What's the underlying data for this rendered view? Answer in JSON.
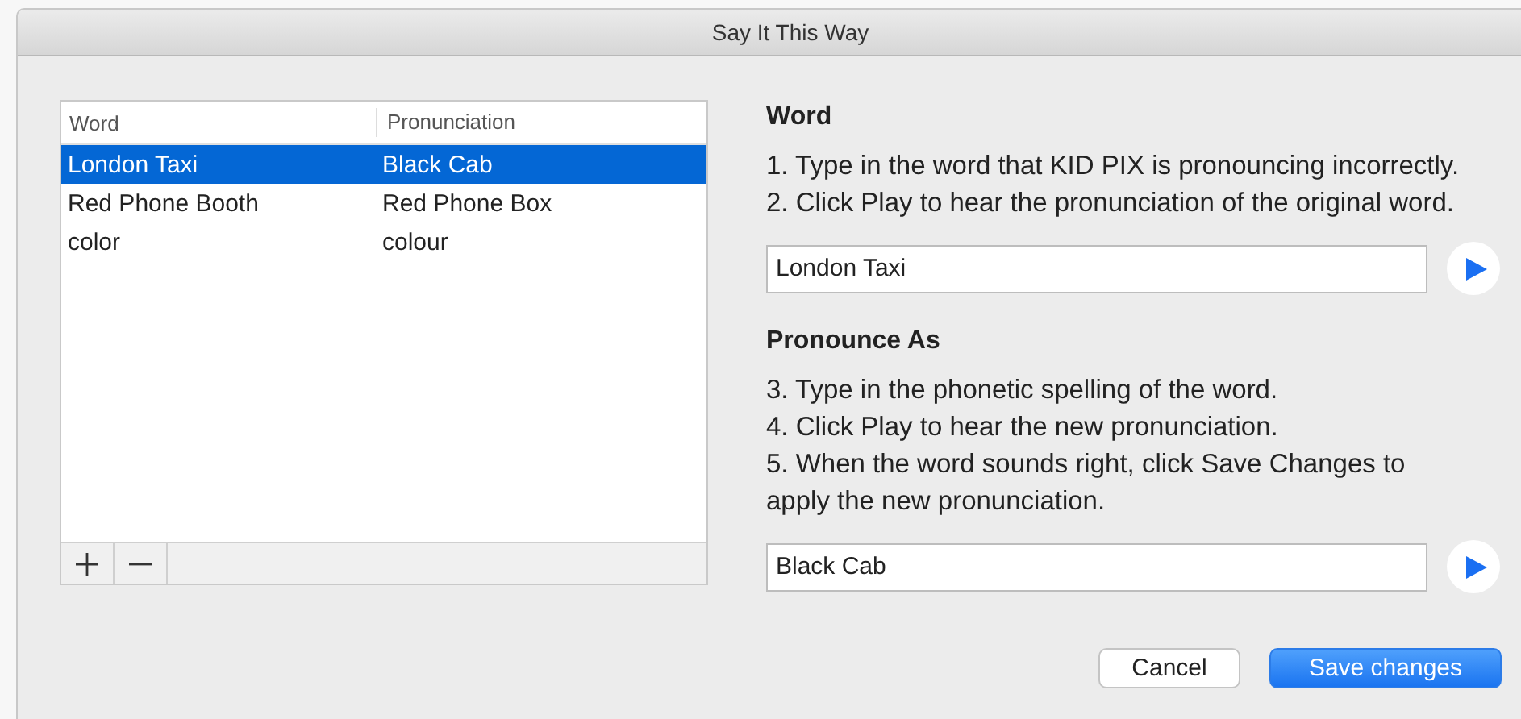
{
  "window": {
    "title": "Say It This Way"
  },
  "table": {
    "columns": [
      "Word",
      "Pronunciation"
    ],
    "rows": [
      {
        "cells": [
          "London Taxi",
          "Black Cab"
        ],
        "selected": true
      },
      {
        "cells": [
          "Red Phone Booth",
          "Red Phone Box"
        ],
        "selected": false
      },
      {
        "cells": [
          "color",
          "colour"
        ],
        "selected": false
      }
    ]
  },
  "sections": [
    {
      "heading": "Word",
      "instructions": [
        "1. Type in the word that KID PIX is pronouncing incorrectly.",
        "2. Click Play to hear the pronunciation of the original word."
      ],
      "field": {
        "value": "London Taxi"
      }
    },
    {
      "heading": "Pronounce As",
      "instructions": [
        "3. Type in the phonetic spelling of the word.",
        "4. Click Play to hear the new pronunciation.",
        "5. When the word sounds right, click Save Changes to apply the new pronunciation."
      ],
      "field": {
        "value": "Black Cab"
      }
    }
  ],
  "buttons": [
    {
      "label": "Cancel",
      "kind": "secondary"
    },
    {
      "label": "Save changes",
      "kind": "primary"
    }
  ]
}
